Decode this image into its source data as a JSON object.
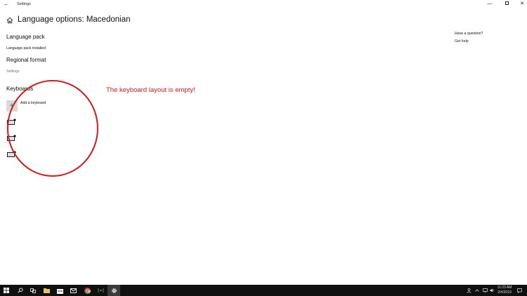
{
  "window": {
    "title": "Settings",
    "back_glyph": "←",
    "minimize_glyph": "—",
    "close_glyph": "✕"
  },
  "page": {
    "title": "Language options: Macedonian"
  },
  "language_pack": {
    "heading": "Language pack",
    "status": "Language pack installed"
  },
  "regional_format": {
    "heading": "Regional format",
    "link": "Settings"
  },
  "keyboards": {
    "heading": "Keyboards",
    "add_label": "Add a keyboard",
    "add_glyph": "+",
    "items": [
      {
        "icon": "keyboard-icon"
      },
      {
        "icon": "keyboard-icon"
      },
      {
        "icon": "keyboard-icon"
      }
    ]
  },
  "sidebar": {
    "question": "Have a question?",
    "help_link": "Get help"
  },
  "annotation": {
    "text": "The keyboard layout is empty!",
    "color": "#d21a1a"
  },
  "taskbar": {
    "time": "11:23 AM",
    "date": "2/4/2019",
    "background": "#101010"
  }
}
